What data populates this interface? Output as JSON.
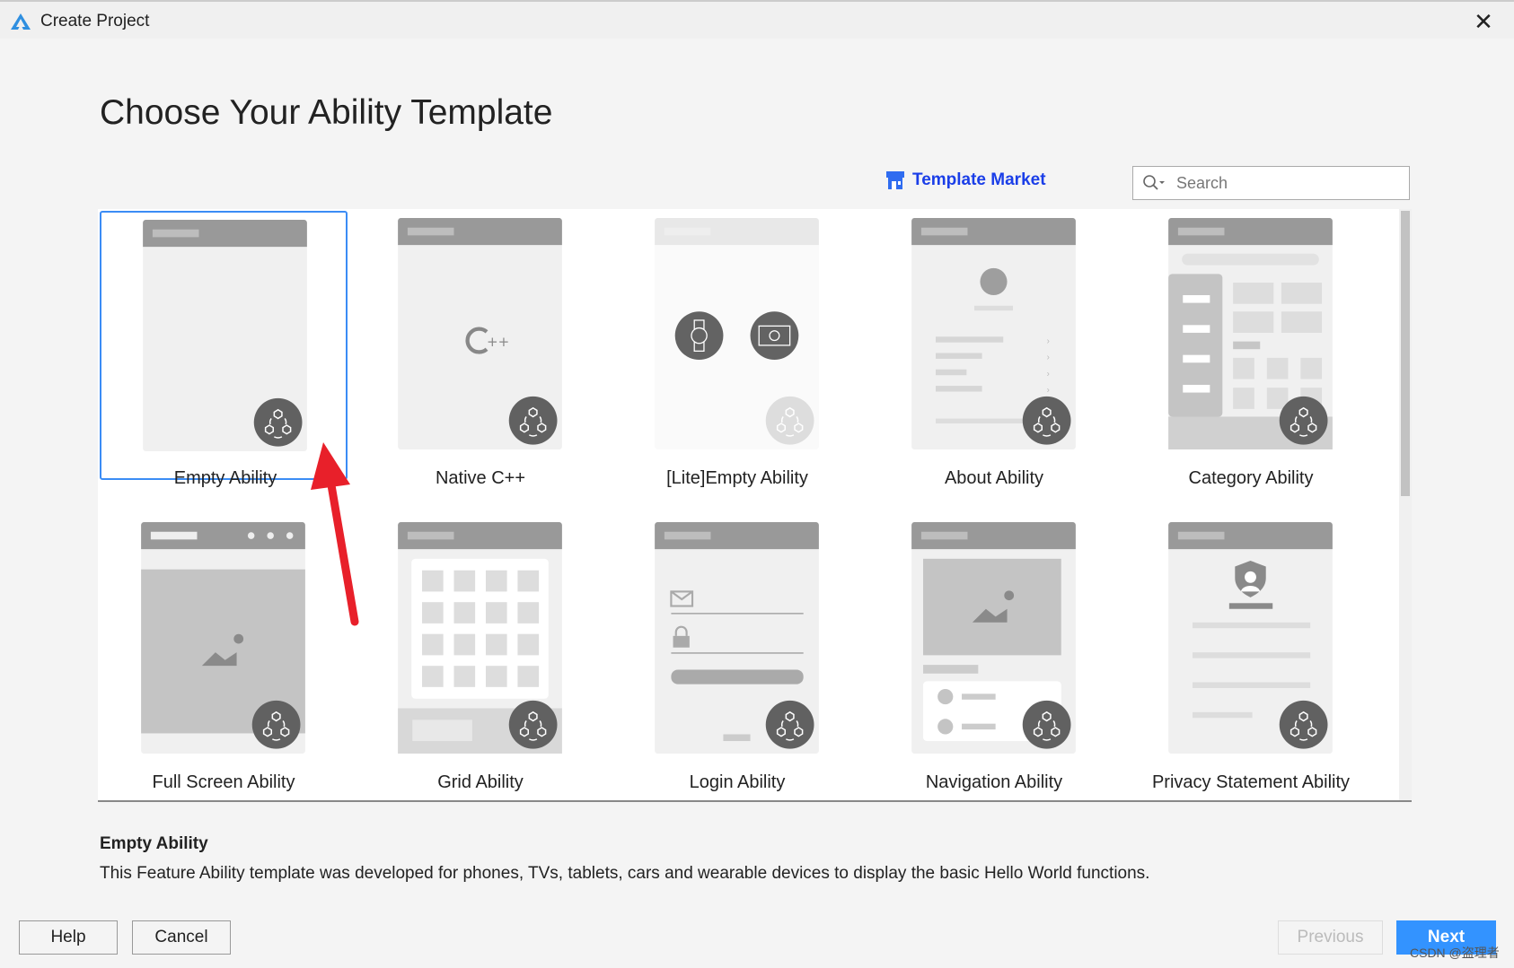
{
  "window": {
    "title": "Create Project",
    "close_icon": "close-icon"
  },
  "heading": "Choose Your Ability Template",
  "template_market": {
    "label": "Template Market",
    "icon": "store-icon",
    "color": "#1a3ee8"
  },
  "search": {
    "placeholder": "Search",
    "value": ""
  },
  "templates": [
    {
      "label": "Empty Ability",
      "type": "empty",
      "selected": true
    },
    {
      "label": "Native C++",
      "type": "cpp",
      "selected": false
    },
    {
      "label": "[Lite]Empty Ability",
      "type": "lite",
      "selected": false
    },
    {
      "label": "About Ability",
      "type": "about",
      "selected": false
    },
    {
      "label": "Category Ability",
      "type": "category",
      "selected": false
    },
    {
      "label": "Full Screen Ability",
      "type": "fullscreen",
      "selected": false
    },
    {
      "label": "Grid Ability",
      "type": "grid",
      "selected": false
    },
    {
      "label": "Login Ability",
      "type": "login",
      "selected": false
    },
    {
      "label": "Navigation Ability",
      "type": "navigation",
      "selected": false
    },
    {
      "label": "Privacy Statement Ability",
      "type": "privacy",
      "selected": false
    }
  ],
  "description": {
    "title": "Empty Ability",
    "text": "This Feature Ability template was developed for phones, TVs, tablets, cars and wearable devices to display the basic Hello World functions."
  },
  "buttons": {
    "help": "Help",
    "cancel": "Cancel",
    "previous": "Previous",
    "next": "Next"
  },
  "watermark": "CSDN @盗理者",
  "colors": {
    "accent": "#3393ff",
    "selection": "#3b8cf5",
    "annotation_arrow": "#e8202a"
  }
}
